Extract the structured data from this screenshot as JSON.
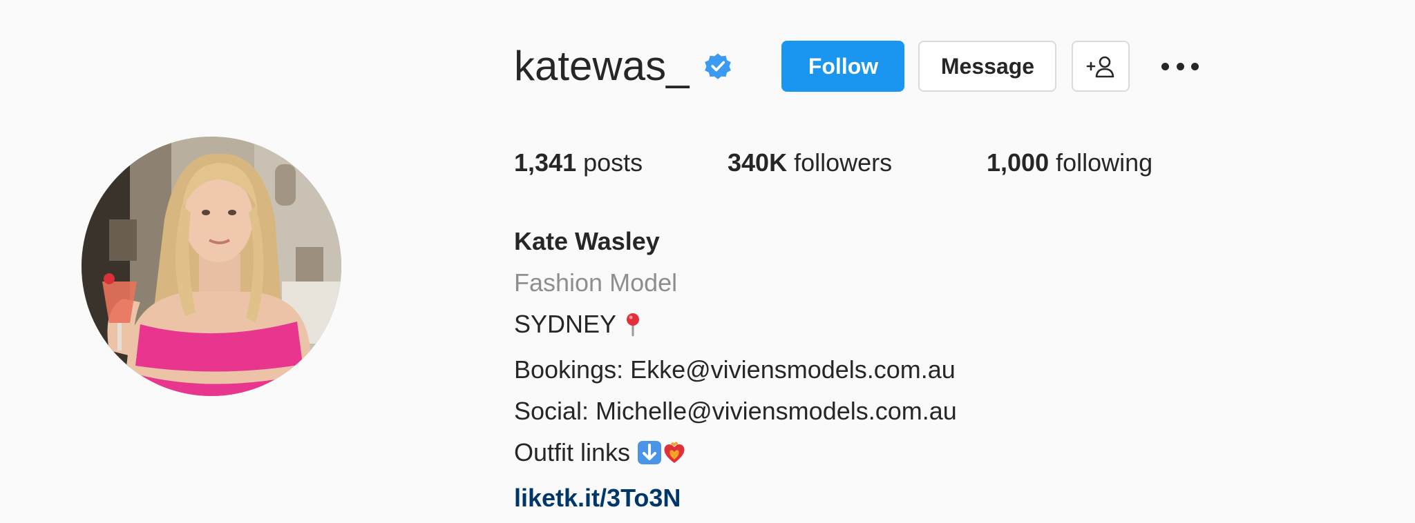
{
  "profile": {
    "username": "katewas_",
    "verified": true
  },
  "actions": {
    "follow_label": "Follow",
    "message_label": "Message"
  },
  "stats": {
    "posts_count": "1,341",
    "posts_label": " posts",
    "followers_count": "340K",
    "followers_label": " followers",
    "following_count": "1,000",
    "following_label": " following"
  },
  "bio": {
    "full_name": "Kate Wasley",
    "category": "Fashion Model",
    "location": "SYDNEY",
    "bookings": "Bookings: Ekke@viviensmodels.com.au",
    "social": "Social: Michelle@viviensmodels.com.au",
    "outfit_links": "Outfit links",
    "link": "liketk.it/3To3N"
  },
  "icons": {
    "verified": "verified-badge-icon",
    "add_user": "add-person-icon",
    "more": "more-options-icon",
    "pin": "round-pushpin-icon",
    "down_arrow": "down-arrow-emoji-icon",
    "heart": "heart-on-fire-emoji-icon"
  },
  "colors": {
    "follow_button": "#1a96f0",
    "verified_badge": "#3b9af1",
    "link": "#00376b",
    "category_text": "#8e8e8e"
  }
}
